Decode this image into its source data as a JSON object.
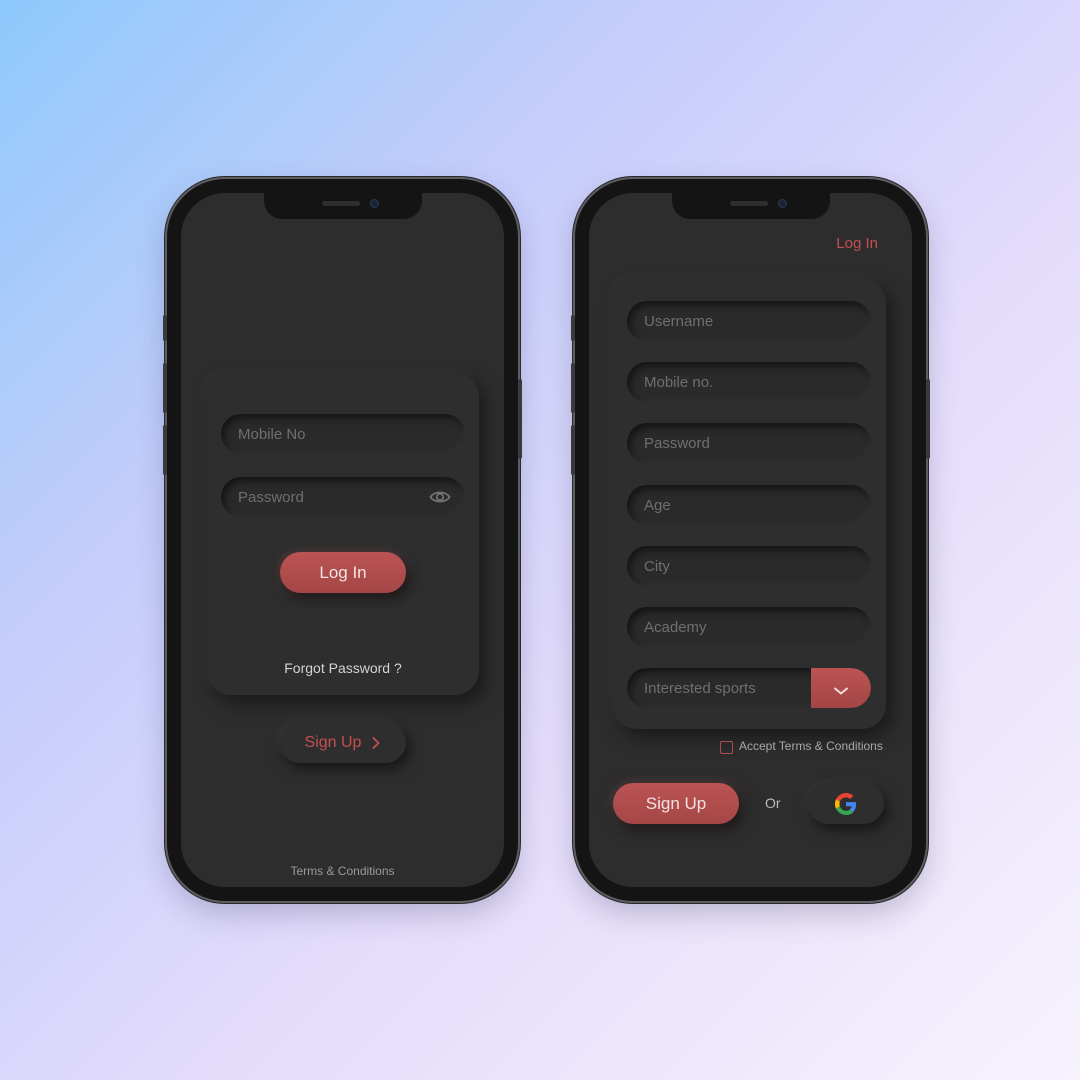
{
  "login_screen": {
    "mobile_placeholder": "Mobile No",
    "password_placeholder": "Password",
    "login_button": "Log In",
    "forgot_password": "Forgot Password ?",
    "signup_button": "Sign Up",
    "terms_link": "Terms & Conditions"
  },
  "signup_screen": {
    "login_link": "Log In",
    "fields": [
      {
        "placeholder": "Username"
      },
      {
        "placeholder": "Mobile no."
      },
      {
        "placeholder": "Password"
      },
      {
        "placeholder": "Age"
      },
      {
        "placeholder": "City"
      },
      {
        "placeholder": "Academy"
      }
    ],
    "sports_select": "Interested sports",
    "accept_terms": "Accept Terms & Conditions",
    "signup_button": "Sign Up",
    "or_text": "Or"
  },
  "icons": {
    "eye": "eye-icon",
    "chevron_right": "chevron-right-icon",
    "chevron_down": "chevron-down-icon",
    "google": "google-icon"
  },
  "colors": {
    "accent": "#b04c4c",
    "screen_bg": "#2d2d2e",
    "placeholder": "#6f6f72"
  }
}
